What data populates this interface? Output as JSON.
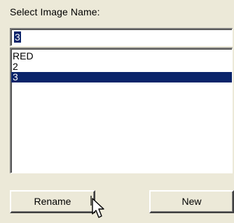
{
  "dialog": {
    "label": "Select Image  Name:"
  },
  "name_input": {
    "value": "3"
  },
  "image_list": {
    "items": [
      "RED",
      "2",
      "3"
    ],
    "selected_index": 2
  },
  "buttons": {
    "rename": "Rename",
    "new": "New"
  },
  "colors": {
    "selection": "#0a246a",
    "panel": "#ece9d8"
  }
}
